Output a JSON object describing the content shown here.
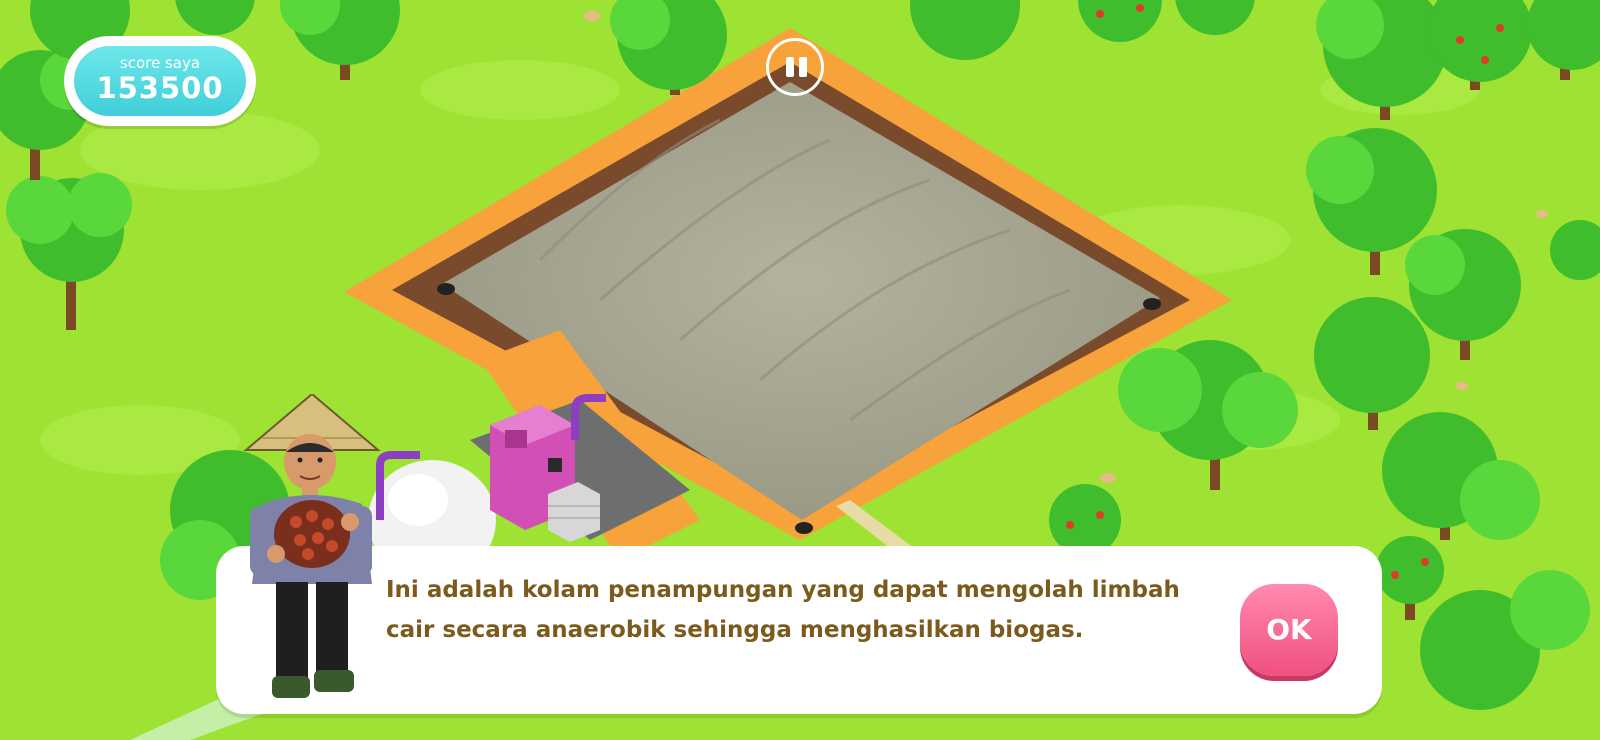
{
  "hud": {
    "score_label": "score saya",
    "score_value": "153500",
    "pause_icon": "pause-icon"
  },
  "dialog": {
    "message": "Ini adalah kolam penampungan yang dapat mengolah limbah cair secara anaerobik sehingga menghasilkan biogas.",
    "ok_label": "OK"
  },
  "colors": {
    "grass": "#9ee233",
    "score_pill": "#4fd8df",
    "dialog_text": "#7b5a1c",
    "ok_button": "#f45f8c",
    "orange_path": "#f7a23a",
    "cover": "#a9a894"
  }
}
